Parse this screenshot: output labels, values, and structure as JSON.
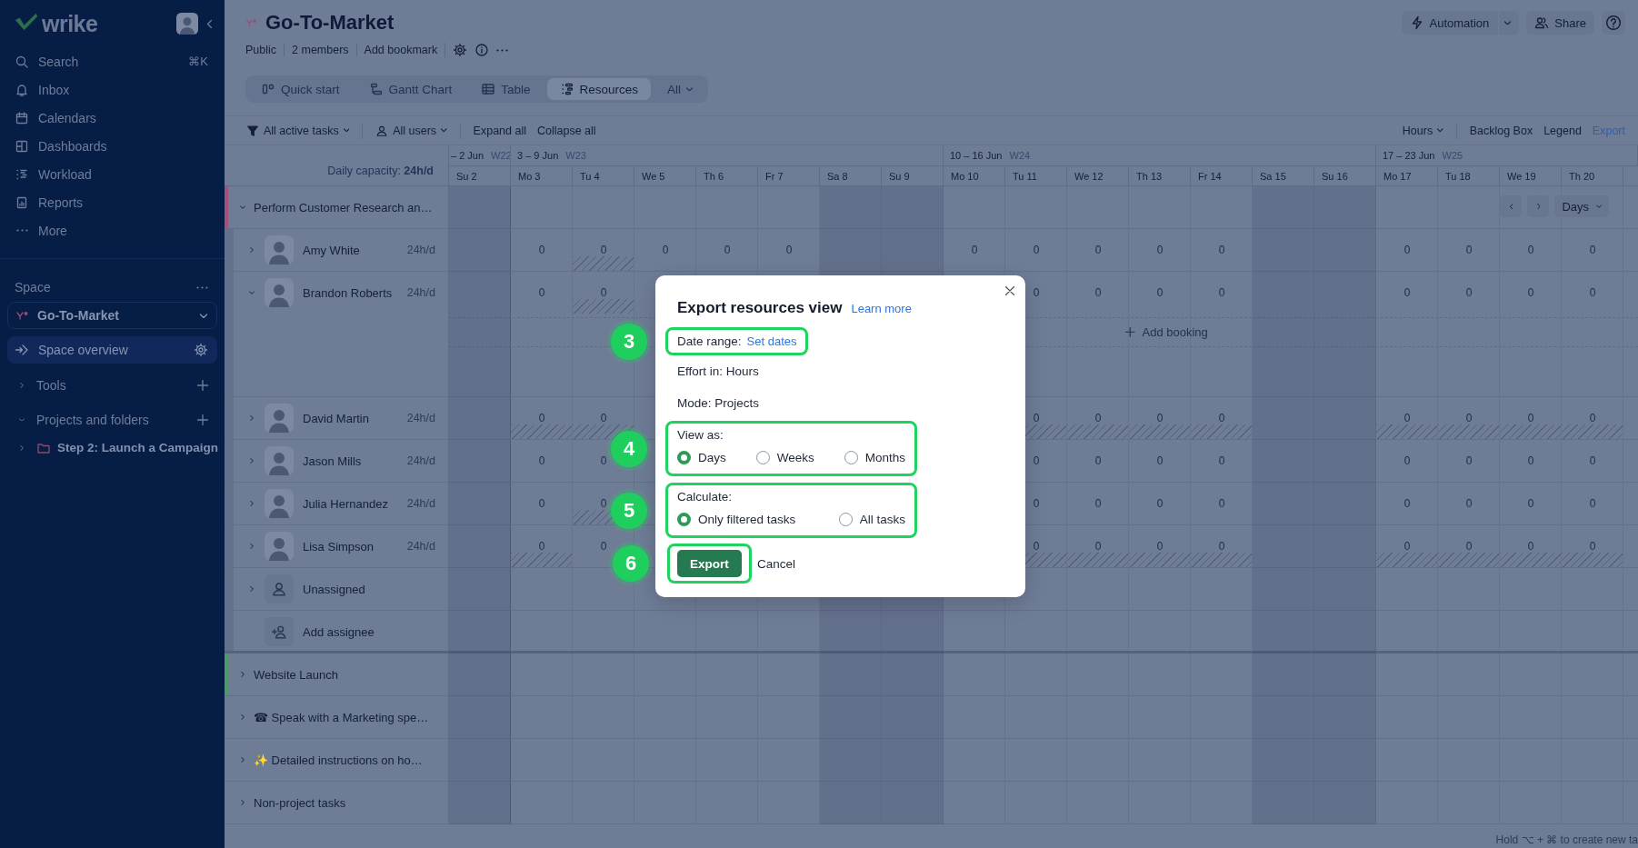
{
  "sidebar": {
    "logo": "wrike",
    "nav": [
      {
        "label": "Search",
        "shortcut": "⌘K"
      },
      {
        "label": "Inbox"
      },
      {
        "label": "Calendars"
      },
      {
        "label": "Dashboards"
      },
      {
        "label": "Workload"
      },
      {
        "label": "Reports"
      },
      {
        "label": "More"
      }
    ],
    "space_label": "Space",
    "space": "Go-To-Market",
    "overview": {
      "label": "Space overview",
      "selected": true
    },
    "sections": [
      {
        "label": "Tools",
        "expanded": false
      },
      {
        "label": "Projects and folders",
        "expanded": true,
        "children": [
          {
            "label": "Step 2: Launch a Campaign",
            "expanded": false
          }
        ]
      }
    ]
  },
  "header": {
    "title": "Go-To-Market",
    "meta": [
      "Public",
      "2 members",
      "Add bookmark"
    ],
    "actions": [
      {
        "label": "Automation",
        "dropdown": true
      },
      {
        "label": "Share"
      }
    ],
    "tabs": [
      {
        "label": "Quick start",
        "selected": false
      },
      {
        "label": "Gantt Chart",
        "selected": false
      },
      {
        "label": "Table",
        "selected": false
      },
      {
        "label": "Resources",
        "selected": true
      },
      {
        "label": "All",
        "dropdown": true,
        "selected": false
      }
    ]
  },
  "toolbar": {
    "left": [
      {
        "label": "All active tasks",
        "dropdown": true
      },
      {
        "label": "All users",
        "dropdown": true
      },
      {
        "label": "Expand all"
      },
      {
        "label": "Collapse all"
      }
    ],
    "right": [
      {
        "label": "Hours",
        "dropdown": true
      },
      {
        "label": "Backlog Box"
      },
      {
        "label": "Legend"
      },
      {
        "label": "Export",
        "link": true
      }
    ]
  },
  "timeline": {
    "capacity": "Daily capacity: **24h/d**",
    "period": "Days",
    "weeks": [
      {
        "range": "– 2 Jun",
        "week": "W22"
      },
      {
        "range": "3 – 9 Jun",
        "week": "W23"
      },
      {
        "range": "10 – 16 Jun",
        "week": "W24"
      },
      {
        "range": "17 – 23 Jun",
        "week": "W25"
      }
    ],
    "days": [
      {
        "label": "Su 2",
        "weekend": true,
        "today": false
      },
      {
        "label": "Mo 3",
        "weekend": false,
        "today": true
      },
      {
        "label": "Tu 4",
        "weekend": false,
        "today": false
      },
      {
        "label": "We 5",
        "weekend": false,
        "today": false
      },
      {
        "label": "Th 6",
        "weekend": false,
        "today": false
      },
      {
        "label": "Fr 7",
        "weekend": false,
        "today": false
      },
      {
        "label": "Sa 8",
        "weekend": true,
        "today": false
      },
      {
        "label": "Su 9",
        "weekend": true,
        "today": false
      },
      {
        "label": "Mo 10",
        "weekend": false,
        "today": false
      },
      {
        "label": "Tu 11",
        "weekend": false,
        "today": false
      },
      {
        "label": "We 12",
        "weekend": false,
        "today": false
      },
      {
        "label": "Th 13",
        "weekend": false,
        "today": false
      },
      {
        "label": "Fr 14",
        "weekend": false,
        "today": false
      },
      {
        "label": "Sa 15",
        "weekend": true,
        "today": false
      },
      {
        "label": "Su 16",
        "weekend": true,
        "today": false
      },
      {
        "label": "Mo 17",
        "weekend": false,
        "today": false
      },
      {
        "label": "Tu 18",
        "weekend": false,
        "today": false
      },
      {
        "label": "We 19",
        "weekend": false,
        "today": false
      },
      {
        "label": "Th 20",
        "weekend": false,
        "today": false
      }
    ],
    "rows": [
      {
        "kind": "project",
        "title": "Perform Customer Research an…",
        "color": "#a3517c",
        "expanded": true,
        "children": [
          {
            "kind": "person",
            "name": "Amy White",
            "capacity": "24h/d",
            "expanded": false,
            "cells": [
              null,
              {
                "value": "0",
                "hatched": false
              },
              {
                "value": "0",
                "hatched": true
              },
              {
                "value": "0",
                "hatched": false
              },
              {
                "value": "0",
                "hatched": false
              },
              {
                "value": "0",
                "hatched": false
              },
              null,
              null,
              {
                "value": "0",
                "hatched": false
              },
              {
                "value": "0",
                "hatched": false
              },
              {
                "value": "0",
                "hatched": false
              },
              {
                "value": "0",
                "hatched": false
              },
              {
                "value": "0",
                "hatched": false
              },
              null,
              null,
              {
                "value": "0",
                "hatched": false
              },
              {
                "value": "0",
                "hatched": false
              },
              {
                "value": "0",
                "hatched": false
              },
              {
                "value": "0",
                "hatched": false
              }
            ]
          },
          {
            "kind": "person",
            "name": "Brandon Roberts",
            "capacity": "24h/d",
            "expanded": true,
            "booking": "Add booking",
            "cells": [
              null,
              {
                "value": "0",
                "hatched": false
              },
              {
                "value": "0",
                "hatched": true
              },
              null,
              null,
              null,
              null,
              null,
              null,
              {
                "value": "0",
                "hatched": false
              },
              {
                "value": "0",
                "hatched": false
              },
              {
                "value": "0",
                "hatched": false
              },
              {
                "value": "0",
                "hatched": false
              },
              null,
              null,
              {
                "value": "0",
                "hatched": false
              },
              {
                "value": "0",
                "hatched": false
              },
              {
                "value": "0",
                "hatched": false
              },
              {
                "value": "0",
                "hatched": false
              }
            ]
          },
          {
            "kind": "person",
            "name": "David Martin",
            "capacity": "24h/d",
            "expanded": false,
            "cells": [
              null,
              {
                "value": "0",
                "hatched": true
              },
              {
                "value": "0",
                "hatched": true
              },
              null,
              null,
              null,
              null,
              null,
              null,
              {
                "value": "0",
                "hatched": true
              },
              {
                "value": "0",
                "hatched": true
              },
              {
                "value": "0",
                "hatched": true
              },
              {
                "value": "0",
                "hatched": true
              },
              null,
              null,
              {
                "value": "0",
                "hatched": true
              },
              {
                "value": "0",
                "hatched": true
              },
              {
                "value": "0",
                "hatched": true
              },
              {
                "value": "0",
                "hatched": true
              }
            ]
          },
          {
            "kind": "person",
            "name": "Jason Mills",
            "capacity": "24h/d",
            "expanded": false,
            "cells": [
              null,
              {
                "value": "0",
                "hatched": false
              },
              {
                "value": "0",
                "hatched": false
              },
              null,
              null,
              null,
              null,
              null,
              null,
              {
                "value": "0",
                "hatched": false
              },
              {
                "value": "0",
                "hatched": false
              },
              {
                "value": "0",
                "hatched": false
              },
              {
                "value": "0",
                "hatched": false
              },
              null,
              null,
              {
                "value": "0",
                "hatched": false
              },
              {
                "value": "0",
                "hatched": false
              },
              {
                "value": "0",
                "hatched": false
              },
              {
                "value": "0",
                "hatched": false
              }
            ]
          },
          {
            "kind": "person",
            "name": "Julia Hernandez",
            "capacity": "24h/d",
            "expanded": false,
            "cells": [
              null,
              {
                "value": "0",
                "hatched": false
              },
              {
                "value": "0",
                "hatched": true
              },
              null,
              null,
              null,
              null,
              null,
              null,
              {
                "value": "0",
                "hatched": false
              },
              {
                "value": "0",
                "hatched": false
              },
              {
                "value": "0",
                "hatched": false
              },
              {
                "value": "0",
                "hatched": false
              },
              null,
              null,
              {
                "value": "0",
                "hatched": false
              },
              {
                "value": "0",
                "hatched": false
              },
              {
                "value": "0",
                "hatched": false
              },
              {
                "value": "0",
                "hatched": false
              }
            ]
          },
          {
            "kind": "person",
            "name": "Lisa Simpson",
            "capacity": "24h/d",
            "expanded": false,
            "cells": [
              null,
              {
                "value": "0",
                "hatched": true
              },
              {
                "value": "0",
                "hatched": false
              },
              null,
              null,
              null,
              null,
              null,
              null,
              {
                "value": "0",
                "hatched": true
              },
              {
                "value": "0",
                "hatched": true
              },
              {
                "value": "0",
                "hatched": true
              },
              {
                "value": "0",
                "hatched": true
              },
              null,
              null,
              {
                "value": "0",
                "hatched": true
              },
              {
                "value": "0",
                "hatched": true
              },
              {
                "value": "0",
                "hatched": true
              },
              {
                "value": "0",
                "hatched": true
              }
            ]
          },
          {
            "kind": "unassigned",
            "name": "Unassigned",
            "expanded": false
          },
          {
            "kind": "add",
            "name": "Add assignee"
          }
        ]
      },
      {
        "kind": "project",
        "title": "Website Launch",
        "color": "#4d9a68",
        "expanded": false
      },
      {
        "kind": "project",
        "title": "☎ Speak with a Marketing spe…",
        "expanded": false
      },
      {
        "kind": "project",
        "title": "✨ Detailed instructions on ho…",
        "expanded": false
      },
      {
        "kind": "project",
        "title": "Non-project tasks",
        "expanded": false
      }
    ],
    "hint": "Hold ⌥ + ⌘ to create new ta"
  },
  "export_dialog": {
    "title": "Export resources view",
    "learn_more": "Learn more",
    "date_range": {
      "label": "Date range:",
      "link": "Set dates",
      "step": "3"
    },
    "effort": "Effort in: Hours",
    "mode": "Mode: Projects",
    "view_as": {
      "label": "View as:",
      "step": "4",
      "options": [
        {
          "label": "Days",
          "selected": true
        },
        {
          "label": "Weeks",
          "selected": false
        },
        {
          "label": "Months",
          "selected": false
        }
      ]
    },
    "calculate": {
      "label": "Calculate:",
      "step": "5",
      "options": [
        {
          "label": "Only filtered tasks",
          "selected": true
        },
        {
          "label": "All tasks",
          "selected": false
        }
      ]
    },
    "export": {
      "label": "Export",
      "step": "6"
    },
    "cancel": "Cancel"
  }
}
